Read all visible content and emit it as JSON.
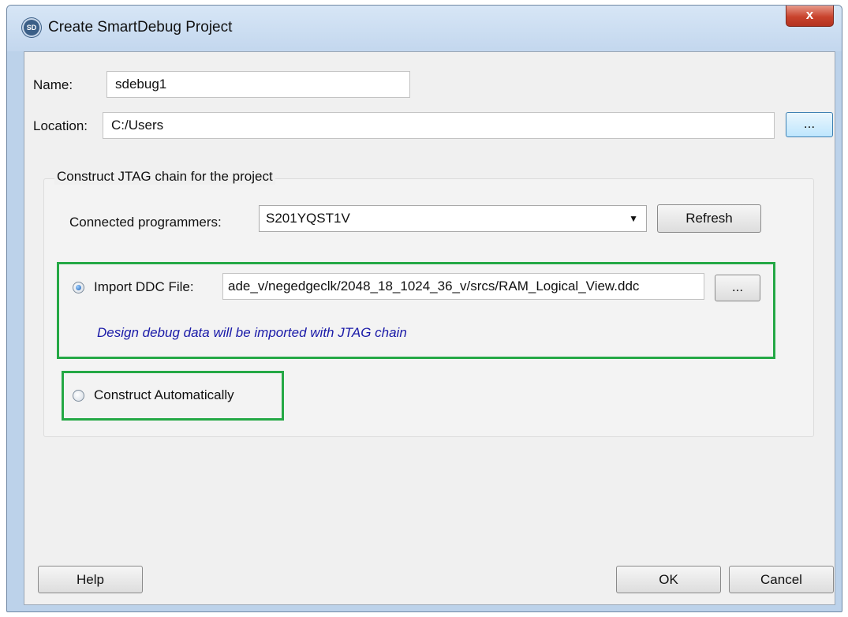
{
  "window": {
    "title": "Create SmartDebug Project",
    "icon_text": "SD",
    "close_glyph": "x"
  },
  "form": {
    "name_label": "Name:",
    "name_value": "sdebug1",
    "location_label": "Location:",
    "location_value": "C:/Users",
    "browse_label": "..."
  },
  "jtag": {
    "group_title": "Construct JTAG chain for the project",
    "programmers_label": "Connected programmers:",
    "programmer_selected": "S201YQST1V",
    "refresh_label": "Refresh",
    "import_option_label": "Import DDC File:",
    "import_selected": true,
    "ddc_path": "ade_v/negedgeclk/2048_18_1024_36_v/srcs/RAM_Logical_View.ddc",
    "ddc_browse_label": "...",
    "import_hint": "Design debug data will be imported with JTAG chain",
    "auto_option_label": "Construct Automatically",
    "auto_selected": false
  },
  "footer": {
    "help_label": "Help",
    "ok_label": "OK",
    "cancel_label": "Cancel"
  },
  "colors": {
    "highlight_border": "#24a845",
    "hint_text": "#1a1aa8",
    "close_button": "#c9432d"
  }
}
